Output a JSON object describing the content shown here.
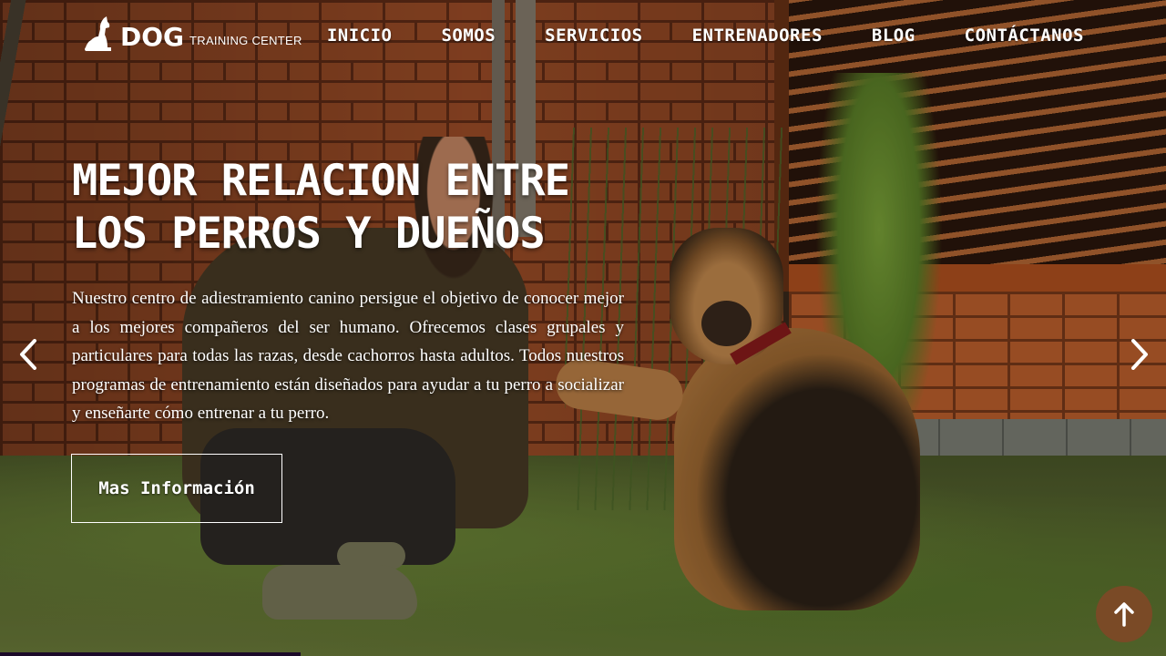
{
  "brand": {
    "name": "DOG",
    "tagline": "TRAINING CENTER"
  },
  "nav": {
    "items": [
      {
        "label": "INICIO"
      },
      {
        "label": "SOMOS"
      },
      {
        "label": "SERVICIOS"
      },
      {
        "label": "ENTRENADORES"
      },
      {
        "label": "BLOG"
      },
      {
        "label": "CONTÁCTANOS"
      }
    ]
  },
  "hero": {
    "title_line1": "MEJOR RELACION ENTRE",
    "title_line2": "LOS PERROS Y DUEÑOS",
    "description": "Nuestro centro de adiestramiento canino persigue el objetivo de conocer mejor a los mejores compañeros del ser humano. Ofrecemos clases grupales y particulares para todas las razas, desde cachorros hasta adultos. Todos nuestros programas de entrenamiento están diseñados para ayudar a tu perro a socializar y enseñarte cómo entrenar a tu perro.",
    "button_label": "Mas Información"
  },
  "controls": {
    "prev_icon": "chevron-left-icon",
    "next_icon": "chevron-right-icon",
    "to_top_icon": "arrow-up-icon"
  },
  "colors": {
    "to_top_bg": "#7a4a26",
    "text": "#ffffff"
  }
}
